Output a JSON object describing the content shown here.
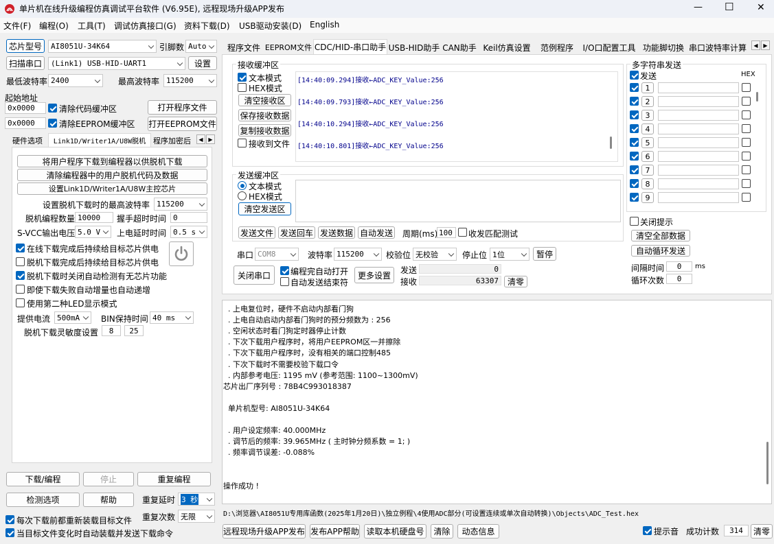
{
  "window": {
    "title": "单片机在线升级编程仿真调试平台软件 (V6.95E), 远程现场升级APP发布",
    "min": "—",
    "max": "☐",
    "close": "✕"
  },
  "menu": [
    "文件(F)",
    "编程(O)",
    "工具(T)",
    "调试仿真接口(G)",
    "资料下载(D)",
    "USB驱动安装(D)",
    "English"
  ],
  "left": {
    "chip_label": "芯片型号",
    "chip_value": "AI8051U-34K64",
    "pin_label": "引脚数",
    "pin_value": "Auto",
    "scan_label": "扫描串口",
    "port_value": "(Link1) USB-HID-UART1",
    "settings_label": "设置",
    "min_baud_label": "最低波特率",
    "min_baud_value": "2400",
    "max_baud_label": "最高波特率",
    "max_baud_value": "115200",
    "start_addr_label": "起始地址",
    "addr1": "0x0000",
    "clear_code": "清除代码缓冲区",
    "open_prog": "打开程序文件",
    "addr2": "0x0000",
    "clear_eeprom": "清除EEPROM缓冲区",
    "open_eeprom": "打开EEPROM文件",
    "tabs": [
      "硬件选项",
      "Link1D/Writer1A/U8W脱机",
      "程序加密后"
    ],
    "offline_btn1": "将用户程序下载到编程器以供脱机下载",
    "offline_btn2": "清除编程器中的用户脱机代码及数据",
    "offline_btn3": "设置Link1D/Writer1A/U8W主控芯片",
    "offline_baud_label": "设置脱机下载时的最高波特率",
    "offline_baud_value": "115200",
    "count_label": "脱机编程数量",
    "count_value": "10000",
    "hs_label": "握手超时时间",
    "hs_value": "0",
    "svcc_label": "S-VCC输出电压",
    "svcc_value": "5.0 V",
    "delay_label": "上电延时时间",
    "delay_value": "0.5 s",
    "opts": [
      {
        "label": "在线下载完成后持续给目标芯片供电",
        "on": true
      },
      {
        "label": "脱机下载完成后持续给目标芯片供电",
        "on": false
      },
      {
        "label": "脱机下载时关闭自动检测有无芯片功能",
        "on": true
      },
      {
        "label": "即使下载失败自动增量也自动递增",
        "on": false
      },
      {
        "label": "使用第二种LED显示模式",
        "on": false
      }
    ],
    "current_label": "提供电流",
    "current_value": "500mA",
    "bin_label": "BIN保持时间",
    "bin_value": "40 ms",
    "sens_label": "脱机下载灵敏度设置",
    "sens1": "8",
    "sens2": "25",
    "download_btn": "下载/编程",
    "stop_btn": "停止",
    "reprogram_btn": "重复编程",
    "check_btn": "检测选项",
    "help_btn": "帮助",
    "redelay_label": "重复延时",
    "redelay_value": "3 秒",
    "recount_label": "重复次数",
    "recount_value": "无限",
    "reload_label": "每次下载前都重新装载目标文件",
    "auto_label": "当目标文件变化时自动装载并发送下载命令"
  },
  "right_tabs": [
    "程序文件",
    "EEPROM文件",
    "CDC/HID-串口助手",
    "USB-HID助手",
    "CAN助手",
    "Keil仿真设置",
    "范例程序",
    "I/O口配置工具",
    "功能脚切换",
    "串口波特率计算"
  ],
  "recv": {
    "group": "接收缓冲区",
    "text_mode": "文本模式",
    "hex_mode": "HEX模式",
    "clear": "清空接收区",
    "save": "保存接收数据",
    "copy": "复制接收数据",
    "to_file": "接收到文件",
    "lines": [
      "[14:40:09.294]接收←ADC_KEY_Value:256",
      "[14:40:09.793]接收←ADC_KEY_Value:256",
      "[14:40:10.294]接收←ADC_KEY_Value:256",
      "[14:40:10.801]接收←ADC_KEY_Value:256"
    ]
  },
  "send": {
    "group": "发送缓冲区",
    "text_mode": "文本模式",
    "hex_mode": "HEX模式",
    "clear": "清空发送区",
    "send_file": "发送文件",
    "send_cr": "发送回车",
    "send_data": "发送数据",
    "auto_send": "自动发送",
    "period_label": "周期(ms)",
    "period_value": "100",
    "match": "收发匹配测试"
  },
  "serial": {
    "port_label": "串口",
    "port_value": "COM8",
    "baud_label": "波特率",
    "baud_value": "115200",
    "parity_label": "校验位",
    "parity_value": "无校验",
    "stop_label": "停止位",
    "stop_value": "1位",
    "pause": "暂停",
    "close": "关闭串口",
    "auto_open": "编程完自动打开",
    "auto_stop": "自动发送结束符",
    "more": "更多设置",
    "sent_label": "发送",
    "sent_value": "0",
    "recv_label": "接收",
    "recv_value": "63307",
    "clear": "清零"
  },
  "multi": {
    "group": "多字符串发送",
    "send": "发送",
    "hex": "HEX",
    "rows": [
      "1",
      "2",
      "3",
      "4",
      "5",
      "6",
      "7",
      "8",
      "9"
    ],
    "close_hint": "关闭提示",
    "clear_all": "清空全部数据",
    "auto_loop": "自动循环发送",
    "interval_label": "间隔时间",
    "interval_value": "0",
    "interval_unit": "ms",
    "loop_label": "循环次数",
    "loop_value": "0"
  },
  "log": [
    "  . 上电复位时，硬件不启动内部看门狗",
    "  . 上电自动启动内部看门狗时的预分频数为 : 256",
    "  . 空闲状态时看门狗定时器停止计数",
    "  . 下次下载用户程序时，将用户EEPROM区一并擦除",
    "  . 下次下载用户程序时，没有相关的端口控制485",
    "  . 下次下载时不需要校验下载口令",
    "  . 内部参考电压: 1195 mV (参考范围: 1100~1300mV)",
    "芯片出厂序列号 : 78B4C993018387",
    "",
    "  单片机型号: AI8051U-34K64",
    "",
    "  . 用户设定频率: 40.000MHz",
    "  . 调节后的频率: 39.965MHz ( 主时钟分频系数 = 1; )",
    "  . 频率调节误差: -0.088%",
    "",
    "",
    "操作成功 !"
  ],
  "path": "D:\\浏览器\\AI8051U专用库函数(2025年1月20日)\\独立例程\\4使用ADC部分(可设置连续或单次自动转换)\\Objects\\ADC_Test.hex",
  "bottom": {
    "remote": "远程现场升级APP发布",
    "publish_help": "发布APP帮助",
    "read_disk": "读取本机硬盘号",
    "clear": "清除",
    "animation": "动态信息",
    "beep": "提示音",
    "success_label": "成功计数",
    "success_value": "314",
    "clear2": "清零"
  }
}
